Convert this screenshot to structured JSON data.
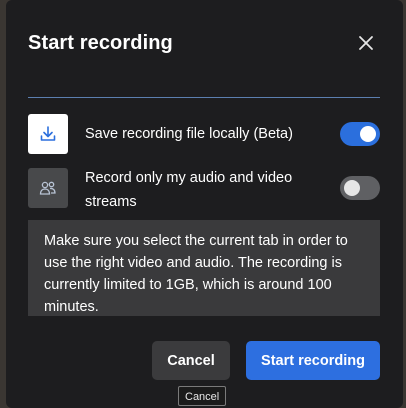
{
  "dialog": {
    "title": "Start recording",
    "close_icon": "close-icon"
  },
  "options": [
    {
      "icon": "download-icon",
      "label": "Save recording file locally (Beta)",
      "enabled": true
    },
    {
      "icon": "people-icon",
      "label": "Record only my audio and video streams",
      "enabled": false
    }
  ],
  "info": {
    "text": "Make sure you select the current tab in order to use the right video and audio. The recording is currently limited to 1GB, which is around 100 minutes."
  },
  "buttons": {
    "cancel_label": "Cancel",
    "start_label": "Start recording"
  },
  "tooltip": {
    "text": "Cancel"
  },
  "colors": {
    "accent": "#2d6fe0",
    "dialog_bg": "#1d1d1f",
    "divider": "#5c7fb0"
  }
}
